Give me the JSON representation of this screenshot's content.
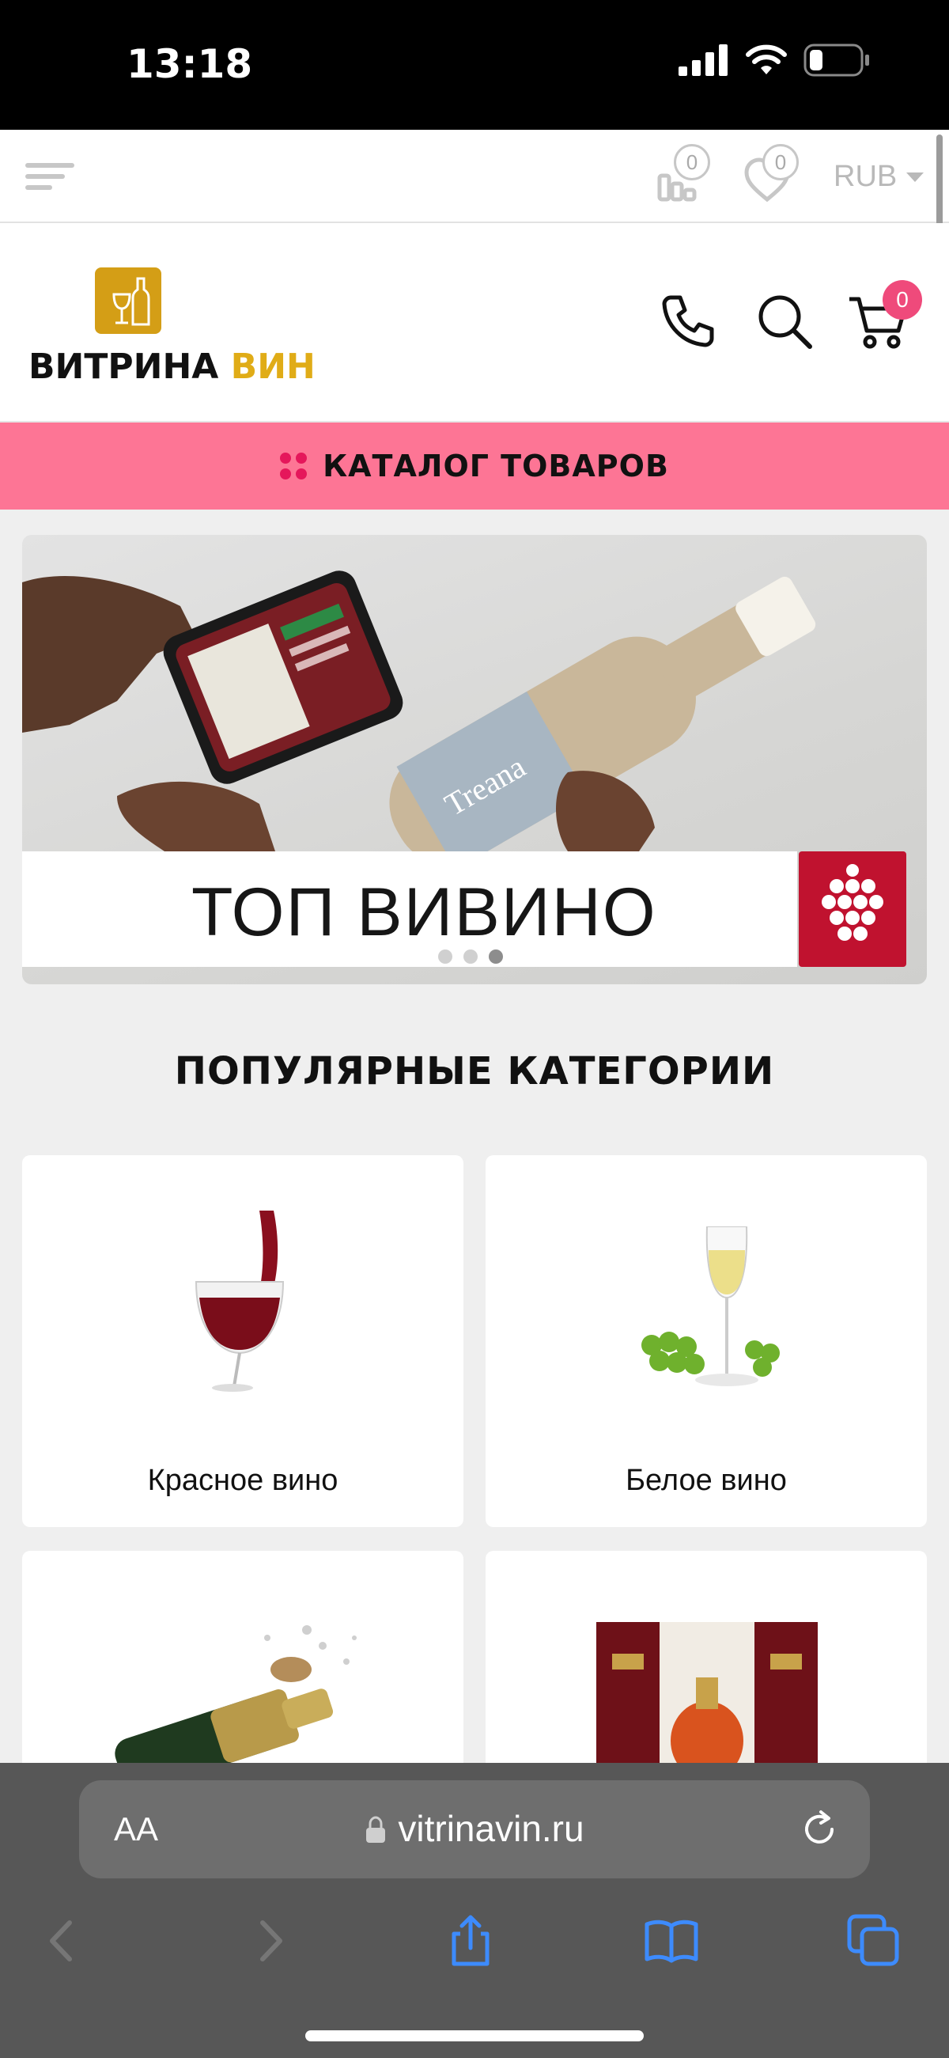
{
  "status_bar": {
    "time": "13:18"
  },
  "util_bar": {
    "compare_count": "0",
    "favorites_count": "0",
    "currency": "RUB"
  },
  "header": {
    "logo_text_1": "ВИТРИНА",
    "logo_text_2": "ВИН",
    "cart_count": "0"
  },
  "catalog": {
    "label": "КАТАЛОГ ТОВАРОВ"
  },
  "banner": {
    "title": "ТОП ВИВИНО",
    "slides": 3,
    "active_slide": 3
  },
  "popular": {
    "title": "ПОПУЛЯРНЫЕ КАТЕГОРИИ",
    "categories": [
      {
        "label": "Красное вино"
      },
      {
        "label": "Белое вино"
      },
      {
        "label": ""
      },
      {
        "label": ""
      }
    ]
  },
  "safari": {
    "text_size_label": "AA",
    "url": "vitrinavin.ru"
  },
  "colors": {
    "accent_pink": "#fd7595",
    "badge_pink": "#ef4a7b",
    "logo_gold": "#d49e16",
    "vivino_red": "#c0122f"
  }
}
